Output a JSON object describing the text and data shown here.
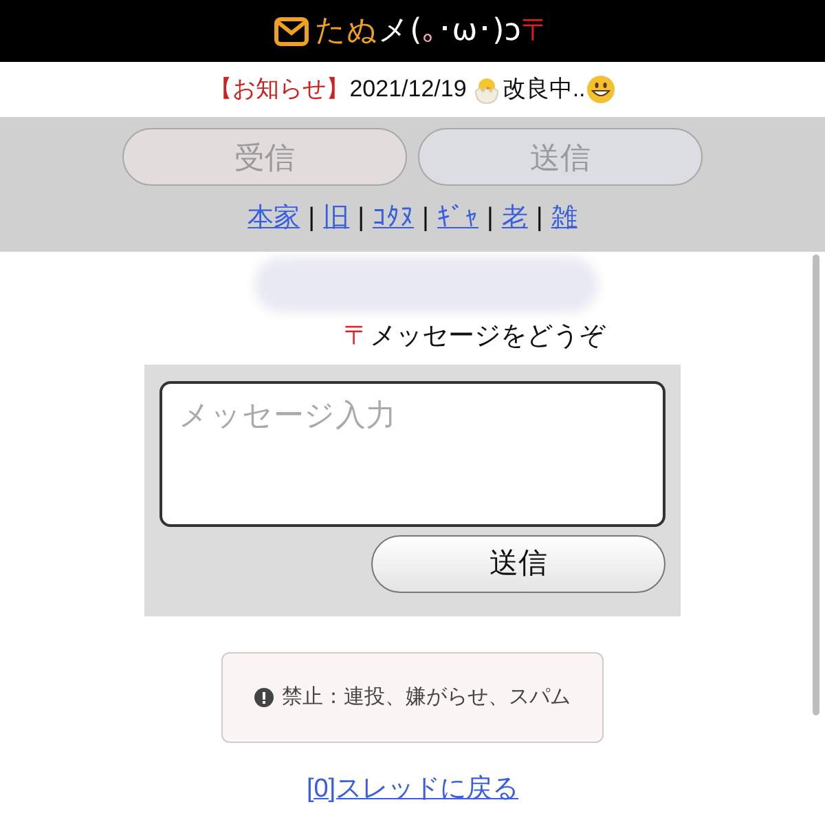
{
  "header": {
    "title_parts": [
      {
        "text": "たぬ",
        "color": "#f0a020"
      },
      {
        "text": "メ(",
        "color": "#ffffff"
      },
      {
        "text": "｡",
        "color": "#f4a8b8"
      },
      {
        "text": "･ω･)ɔ",
        "color": "#ffffff"
      },
      {
        "text": "〒",
        "color": "#e02020"
      }
    ]
  },
  "notice": {
    "label": "【お知らせ】",
    "date": "2021/12/19",
    "text": "改良中.."
  },
  "tabs": [
    {
      "label": "受信",
      "selected": false
    },
    {
      "label": "送信",
      "selected": false
    }
  ],
  "links": [
    "本家",
    "旧",
    "ｺﾀﾇ",
    "ｷﾞｬ",
    "老",
    "雑"
  ],
  "separator": "|",
  "prompt": {
    "mark": "〒",
    "text": "メッセージをどうぞ"
  },
  "form": {
    "placeholder": "メッセージ入力",
    "button": "送信"
  },
  "rules": "禁止：連投、嫌がらせ、スパム",
  "back_link": "[0]スレッドに戻る"
}
